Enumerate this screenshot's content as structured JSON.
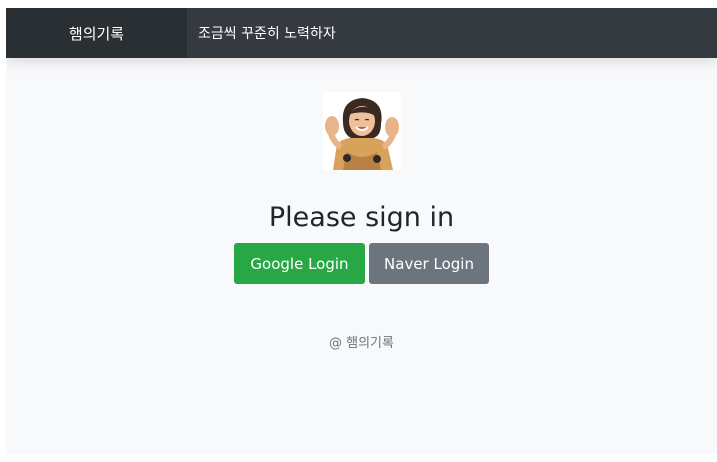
{
  "navbar": {
    "brand": "햄의기록",
    "motto": "조금씩 꾸준히 노력하자"
  },
  "login": {
    "title": "Please sign in",
    "google_button": "Google Login",
    "naver_button": "Naver Login"
  },
  "footer": {
    "text": "@ 햄의기록"
  },
  "colors": {
    "navbar": "#343a40",
    "brand_bg": "#2a2f34",
    "google": "#28a745",
    "naver": "#6c757d",
    "page_bg": "#f8f9fa"
  }
}
